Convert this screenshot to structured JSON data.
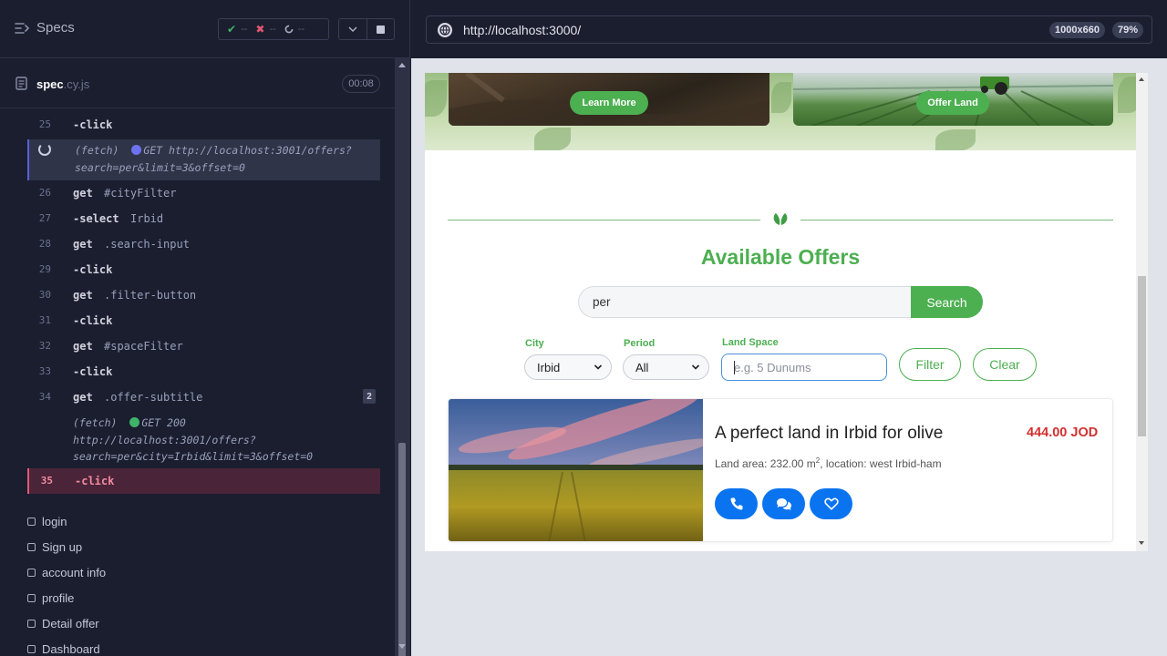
{
  "reporter": {
    "specs_label": "Specs",
    "stats": {
      "passed": "--",
      "failed": "--",
      "pending": "--"
    },
    "spec_file": {
      "name": "spec",
      "ext": ".cy.js",
      "duration": "00:08"
    },
    "commands": [
      {
        "num": "25",
        "name": "-click",
        "message": ""
      },
      {
        "num": "26",
        "name": "get",
        "message": "#cityFilter"
      },
      {
        "num": "27",
        "name": "-select",
        "message": "Irbid"
      },
      {
        "num": "28",
        "name": "get",
        "message": ".search-input"
      },
      {
        "num": "29",
        "name": "-click",
        "message": ""
      },
      {
        "num": "30",
        "name": "get",
        "message": ".filter-button"
      },
      {
        "num": "31",
        "name": "-click",
        "message": ""
      },
      {
        "num": "32",
        "name": "get",
        "message": "#spaceFilter"
      },
      {
        "num": "33",
        "name": "-click",
        "message": ""
      },
      {
        "num": "34",
        "name": "get",
        "message": ".offer-subtitle",
        "badge": "2"
      }
    ],
    "fetch_pending": {
      "label": "(fetch)",
      "method": "GET",
      "line1": "http://localhost:3001/offers?",
      "line2": "search=per&limit=3&offset=0",
      "dot_color": "#6e72f0"
    },
    "fetch_done": {
      "label": "(fetch)",
      "method": "GET 200",
      "line1": "http://localhost:3001/offers?",
      "line2": "search=per&city=Irbid&limit=3&offset=0",
      "dot_color": "#3fb36a"
    },
    "active_command": {
      "num": "35",
      "name": "-click"
    },
    "tests": [
      "login",
      "Sign up",
      "account info",
      "profile",
      "Detail offer",
      "Dashboard"
    ]
  },
  "browser": {
    "url": "http://localhost:3000/",
    "viewport": "1000x660",
    "zoom": "79%"
  },
  "app": {
    "hero": {
      "learn_more": "Learn More",
      "offer_land": "Offer Land"
    },
    "section_title": "Available Offers",
    "search": {
      "value": "per",
      "button": "Search"
    },
    "filters": {
      "city_label": "City",
      "city_value": "Irbid",
      "period_label": "Period",
      "period_value": "All",
      "space_label": "Land Space",
      "space_placeholder": "e.g. 5 Dunums",
      "filter_button": "Filter",
      "clear_button": "Clear"
    },
    "offer": {
      "title": "A perfect land in Irbid for olive",
      "price": "444.00 JOD",
      "desc_prefix": "Land area: 232.00 m",
      "desc_sup": "2",
      "desc_suffix": ", location: west Irbid-ham"
    },
    "colors": {
      "primary_green": "#4caf50",
      "price_red": "#d32f2f",
      "action_blue": "#0a74f0"
    }
  }
}
